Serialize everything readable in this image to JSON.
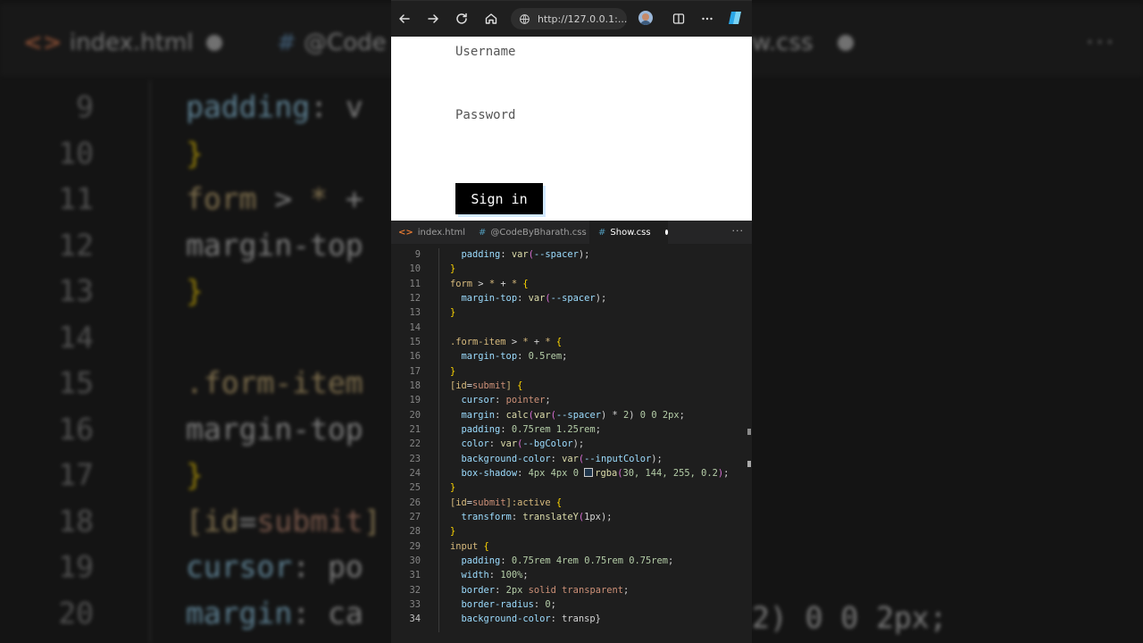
{
  "browser": {
    "url": "http://127.0.0.1:..."
  },
  "page": {
    "username_label": "Username",
    "password_label": "Password",
    "signin_label": "Sign in"
  },
  "editor_tabs": [
    {
      "label": "index.html",
      "icon": "html-file-icon"
    },
    {
      "label": "@CodeByBharath.css",
      "icon": "css-file-icon"
    },
    {
      "label": "Show.css",
      "icon": "css-file-icon"
    }
  ],
  "background_tabs": {
    "tab1": "index.html",
    "tab2": "@Code",
    "tab3": "w.css"
  },
  "background_lines": [
    {
      "n": "9",
      "code": "  padding: v"
    },
    {
      "n": "10",
      "code": "}"
    },
    {
      "n": "11",
      "code": "form > * +"
    },
    {
      "n": "12",
      "code": "  margin-top"
    },
    {
      "n": "13",
      "code": "}"
    },
    {
      "n": "14",
      "code": ""
    },
    {
      "n": "15",
      "code": ".form-item"
    },
    {
      "n": "16",
      "code": "  margin-top"
    },
    {
      "n": "17",
      "code": "}"
    },
    {
      "n": "18",
      "code": "[id=submit]"
    },
    {
      "n": "19",
      "code": "  cursor: po"
    },
    {
      "n": "20",
      "code": "  margin: ca"
    }
  ],
  "background_right_snippet": "2) 0 0 2px;",
  "code_lines": [
    {
      "n": "9",
      "code": "  padding: var(--spacer);"
    },
    {
      "n": "10",
      "code": "}"
    },
    {
      "n": "11",
      "code": "form > * + * {"
    },
    {
      "n": "12",
      "code": "  margin-top: var(--spacer);"
    },
    {
      "n": "13",
      "code": "}"
    },
    {
      "n": "14",
      "code": ""
    },
    {
      "n": "15",
      "code": ".form-item > * + * {"
    },
    {
      "n": "16",
      "code": "  margin-top: 0.5rem;"
    },
    {
      "n": "17",
      "code": "}"
    },
    {
      "n": "18",
      "code": "[id=submit] {"
    },
    {
      "n": "19",
      "code": "  cursor: pointer;"
    },
    {
      "n": "20",
      "code": "  margin: calc(var(--spacer) * 2) 0 0 2px;"
    },
    {
      "n": "21",
      "code": "  padding: 0.75rem 1.25rem;"
    },
    {
      "n": "22",
      "code": "  color: var(--bgColor);"
    },
    {
      "n": "23",
      "code": "  background-color: var(--inputColor);"
    },
    {
      "n": "24",
      "code": "  box-shadow: 4px 4px 0 rgba(30, 144, 255, 0.2);"
    },
    {
      "n": "25",
      "code": "}"
    },
    {
      "n": "26",
      "code": "[id=submit]:active {"
    },
    {
      "n": "27",
      "code": "  transform: translateY(1px);"
    },
    {
      "n": "28",
      "code": "}"
    },
    {
      "n": "29",
      "code": "input {"
    },
    {
      "n": "30",
      "code": "  padding: 0.75rem 4rem 0.75rem 0.75rem;"
    },
    {
      "n": "31",
      "code": "  width: 100%;"
    },
    {
      "n": "32",
      "code": "  border: 2px solid transparent;"
    },
    {
      "n": "33",
      "code": "  border-radius: 0;"
    },
    {
      "n": "34",
      "code": "  background-color: transp}"
    }
  ],
  "colors": {
    "editor_bg": "#1e1e1e",
    "selector": "#d7ba7d",
    "property": "#9cdcfe",
    "value": "#ce9178",
    "number": "#b5cea8",
    "function": "#dcdcaa",
    "bracket": "#ffd700"
  }
}
